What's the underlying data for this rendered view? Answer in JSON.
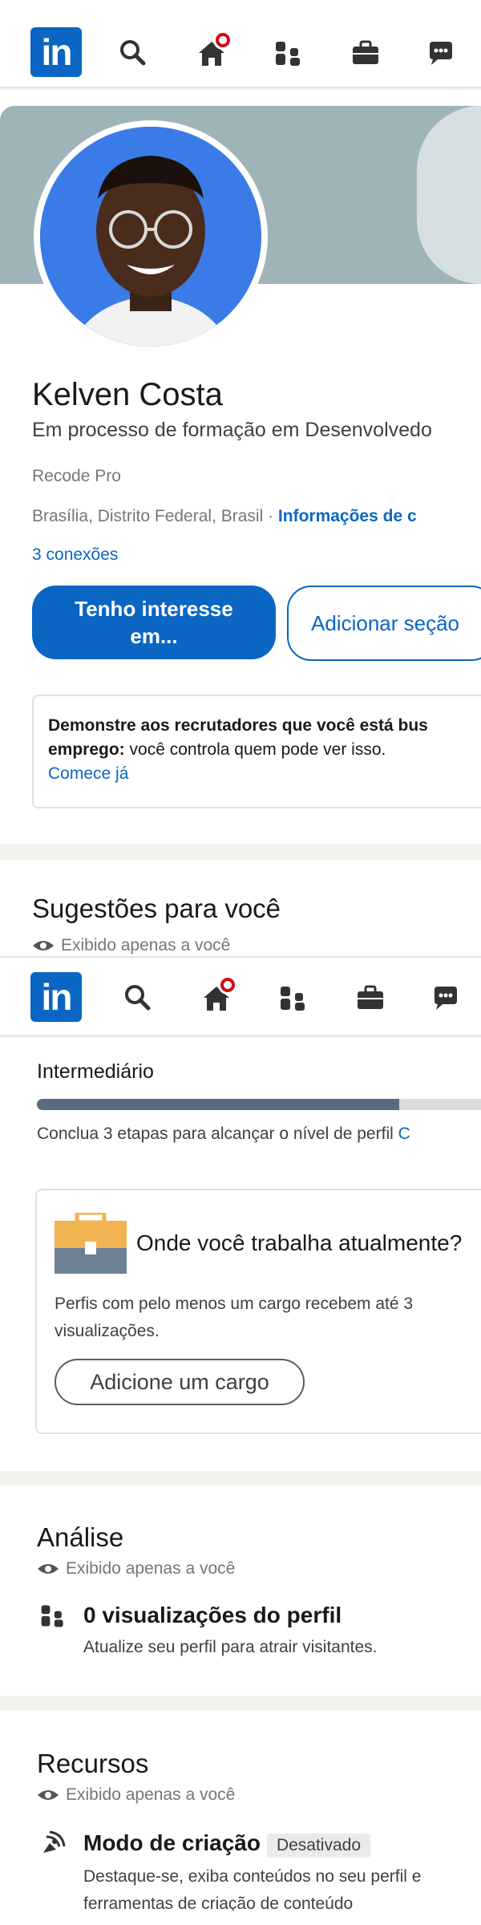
{
  "nav": {
    "logo_text": "in",
    "icons": [
      "search-icon",
      "home-icon",
      "network-icon",
      "jobs-icon",
      "messaging-icon"
    ]
  },
  "profile": {
    "name": "Kelven Costa",
    "headline": "Em processo de formação em Desenvolvedo",
    "company": "Recode Pro",
    "location": "Brasília, Distrito Federal, Brasil · ",
    "contact_link": "Informações de c",
    "connections": "3 conexões",
    "primary_button": [
      "Tenho interesse",
      "em..."
    ],
    "secondary_button": "Adicionar seção"
  },
  "open_to_work": {
    "line1": "Demonstre aos recrutadores que você está bus",
    "line2_bold": "emprego:",
    "line2_rest": " você controla quem pode ver isso.",
    "cta": "Comece já"
  },
  "suggestions": {
    "title": "Sugestões para você",
    "visibility": "Exibido apenas a você",
    "level": "Intermediário",
    "progress_fraction": 0.78,
    "progress_text": "Conclua 3 etapas para alcançar o nível de perfil ",
    "progress_link": "C",
    "role_card": {
      "title": "Onde você trabalha atualmente?",
      "desc_line1": "Perfis com pelo menos um cargo recebem até 3",
      "desc_line2": "visualizações.",
      "button": "Adicione um cargo"
    }
  },
  "analytics": {
    "title": "Análise",
    "visibility": "Exibido apenas a você",
    "item_title": "0 visualizações do perfil",
    "item_sub": "Atualize seu perfil para atrair visitantes."
  },
  "resources": {
    "title": "Recursos",
    "visibility": "Exibido apenas a você",
    "item_title": "Modo de criação",
    "item_badge": "Desativado",
    "item_sub": "Destaque-se, exiba conteúdos no seu perfil e",
    "item_sub2": "ferramentas de criação de conteúdo"
  },
  "colors": {
    "brand": "#0a66c2",
    "notification": "#cc1016",
    "progress_fill": "#5a6b7d"
  }
}
